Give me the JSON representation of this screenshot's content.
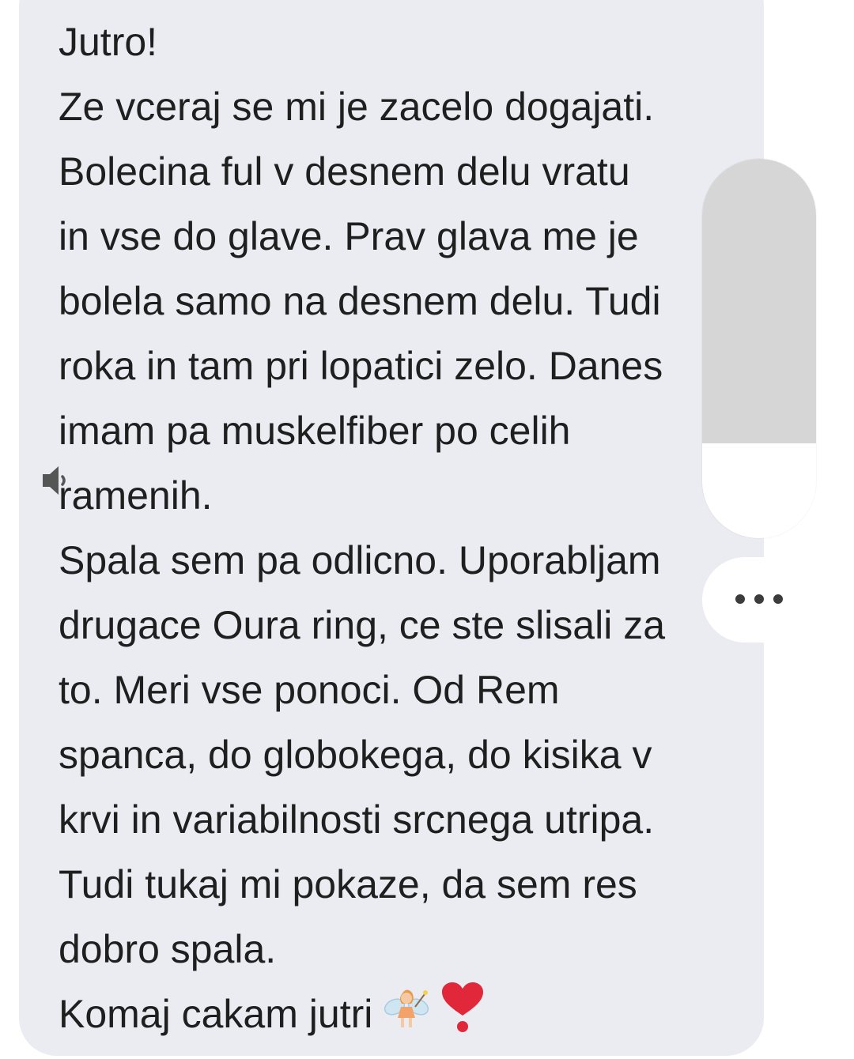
{
  "message": {
    "lines": [
      "Jutro!",
      "Ze vceraj se mi je zacelo dogajati.",
      "Bolecina ful v desnem delu vratu",
      "in vse do glave. Prav glava me je",
      "bolela samo na desnem delu. Tudi",
      "roka in tam pri lopatici zelo. Danes",
      "imam pa muskelfiber po celih",
      "ramenih.",
      "Spala sem pa odlicno. Uporabljam",
      "drugace Oura ring, ce ste slisali za",
      "to. Meri vse ponoci. Od Rem",
      "spanca, do globokega, do kisika v",
      "krvi in variabilnosti srcnega utripa.",
      "Tudi tukaj mi pokaze, da sem res",
      "dobro spala.",
      "Komaj cakam jutri"
    ],
    "emojis": [
      "fairy-emoji",
      "heart-exclamation-emoji"
    ]
  },
  "volume_panel": {
    "level": 0.25,
    "icon": "speaker-icon",
    "more_icon": "more-horizontal-icon"
  },
  "colors": {
    "bubble": "#eaecf1",
    "text": "#1f1f1f",
    "slider_track": "#d6d6d6",
    "heart": "#e0283a"
  }
}
